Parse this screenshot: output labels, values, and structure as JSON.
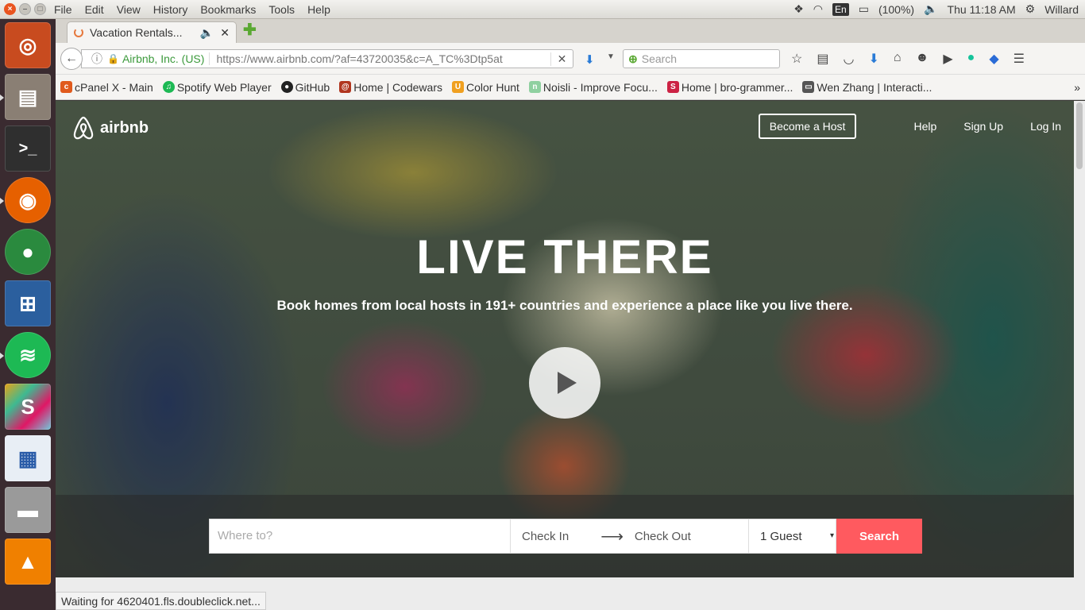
{
  "panel": {
    "menus": [
      "File",
      "Edit",
      "View",
      "History",
      "Bookmarks",
      "Tools",
      "Help"
    ],
    "lang": "En",
    "battery": "(100%)",
    "clock": "Thu 11:18 AM",
    "user": "Willard"
  },
  "launcher": {
    "icons": [
      "ubuntu-icon",
      "files-icon",
      "terminal-icon",
      "firefox-icon",
      "chrome-icon",
      "app-icon",
      "spotify-icon",
      "slack-icon",
      "writer-icon",
      "disk-icon",
      "vlc-icon"
    ]
  },
  "tab": {
    "title": "Vacation Rentals...",
    "close": "✕"
  },
  "nav": {
    "org": "Airbnb, Inc. (US)",
    "url": "https://www.airbnb.com/?af=43720035&c=A_TC%3Dtp5at",
    "search_placeholder": "Search"
  },
  "bookmarks": [
    {
      "label": "cPanel X - Main",
      "color": "#e05a1c",
      "glyph": "c"
    },
    {
      "label": "Spotify Web Player",
      "color": "#1db954",
      "glyph": "♫"
    },
    {
      "label": "GitHub",
      "color": "#222222",
      "glyph": "●"
    },
    {
      "label": "Home | Codewars",
      "color": "#b1361e",
      "glyph": "@"
    },
    {
      "label": "Color Hunt",
      "color": "#f0a020",
      "glyph": "U"
    },
    {
      "label": "Noisli - Improve Focu...",
      "color": "#8fd0a0",
      "glyph": "n"
    },
    {
      "label": "Home | bro-grammer...",
      "color": "#cc2244",
      "glyph": "S"
    },
    {
      "label": "Wen Zhang | Interacti...",
      "color": "#555555",
      "glyph": "▭"
    }
  ],
  "page": {
    "brand": "airbnb",
    "become_host": "Become a Host",
    "help": "Help",
    "sign_up": "Sign Up",
    "log_in": "Log In",
    "hero_title": "LIVE THERE",
    "hero_sub": "Book homes from local hosts in 191+ countries and experience a place like you live there.",
    "where_placeholder": "Where to?",
    "check_in": "Check In",
    "check_out": "Check Out",
    "guests": "1 Guest",
    "search": "Search"
  },
  "status": "Waiting for 4620401.fls.doubleclick.net...",
  "colors": {
    "accent": "#ff5a5f",
    "ubuntu_orange": "#e95420"
  }
}
